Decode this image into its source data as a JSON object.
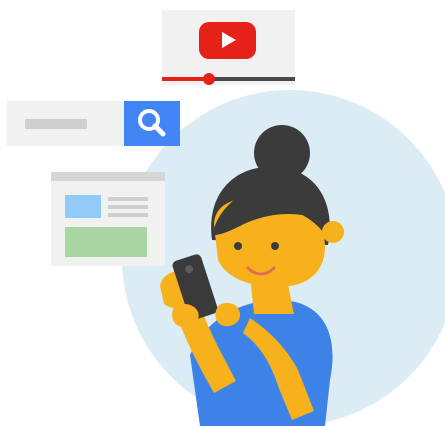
{
  "video_card": {
    "icon": "play-icon",
    "progress": 0.35
  },
  "search_card": {
    "icon": "search-icon"
  },
  "page_card": {
    "icon": "webpage-icon"
  },
  "colors": {
    "circle": "#dcecf4",
    "video_red": "#e62117",
    "search_blue": "#4285f4",
    "skin": "#f6b11c",
    "hair": "#3b3b3b",
    "shirt": "#3d83e7",
    "phone": "#3a3a3a"
  }
}
